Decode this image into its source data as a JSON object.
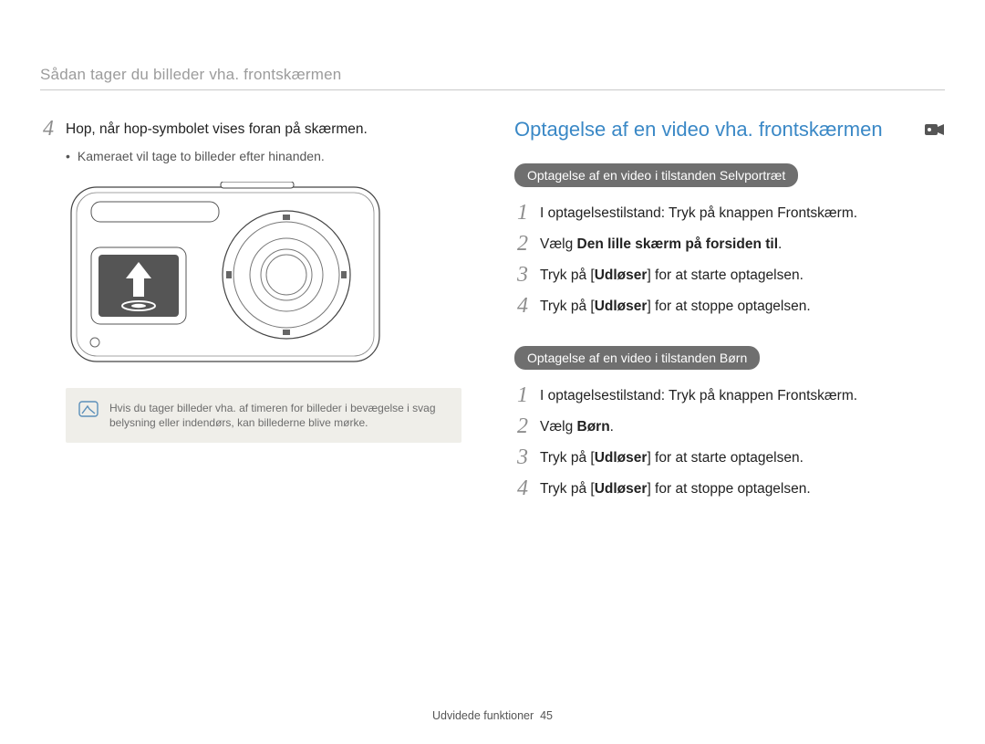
{
  "section_header": "Sådan tager du billeder vha. frontskærmen",
  "left": {
    "step4_num": "4",
    "step4_text": "Hop, når hop-symbolet vises foran på skærmen.",
    "bullet": "Kameraet vil tage to billeder efter hinanden.",
    "note": "Hvis du tager billeder vha. af timeren for billeder i bevægelse i svag belysning eller indendørs, kan billederne blive mørke."
  },
  "right": {
    "heading": "Optagelse af en video vha. frontskærmen",
    "section_a": {
      "pill": "Optagelse af en video i tilstanden Selvportræt",
      "steps": {
        "s1_num": "1",
        "s1_text": "I optagelsestilstand: Tryk på knappen Frontskærm.",
        "s2_num": "2",
        "s2_prefix": "Vælg ",
        "s2_bold": "Den lille skærm på forsiden til",
        "s2_suffix": ".",
        "s3_num": "3",
        "s3_prefix": "Tryk på [",
        "s3_bold": "Udløser",
        "s3_suffix": "] for at starte optagelsen.",
        "s4_num": "4",
        "s4_prefix": "Tryk på [",
        "s4_bold": "Udløser",
        "s4_suffix": "] for at stoppe optagelsen."
      }
    },
    "section_b": {
      "pill": "Optagelse af en video i tilstanden Børn",
      "steps": {
        "s1_num": "1",
        "s1_text": "I optagelsestilstand: Tryk på knappen Frontskærm.",
        "s2_num": "2",
        "s2_prefix": "Vælg ",
        "s2_bold": "Børn",
        "s2_suffix": ".",
        "s3_num": "3",
        "s3_prefix": "Tryk på [",
        "s3_bold": "Udløser",
        "s3_suffix": "] for at starte optagelsen.",
        "s4_num": "4",
        "s4_prefix": "Tryk på [",
        "s4_bold": "Udløser",
        "s4_suffix": "] for at stoppe optagelsen."
      }
    }
  },
  "footer": {
    "label": "Udvidede funktioner",
    "page": "45"
  }
}
